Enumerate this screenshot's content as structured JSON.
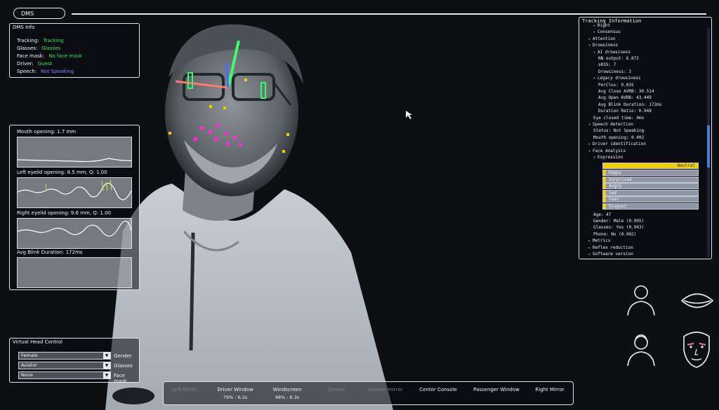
{
  "header": {
    "tab_label": "DMS"
  },
  "dms_info": {
    "title": "DMS Info",
    "rows": [
      {
        "label": "Tracking:",
        "value": "Tracking",
        "color": "#39e65c"
      },
      {
        "label": "Glasses:",
        "value": "Glasses",
        "color": "#39e65c"
      },
      {
        "label": "Face mask:",
        "value": "No face mask",
        "color": "#39e65c"
      },
      {
        "label": "Driver:",
        "value": "Guest",
        "color": "#39e65c"
      },
      {
        "label": "Speech:",
        "value": "Not Speaking",
        "color": "#7f8cff"
      }
    ]
  },
  "graphs": [
    {
      "label": "Mouth opening: 1.7 mm"
    },
    {
      "label": "Left eyelid opening: 8.5 mm, Q: 1.00"
    },
    {
      "label": "Right eyelid opening: 9.6 mm, Q: 1.00"
    },
    {
      "label": "Avg Blink Duration: 172ms"
    }
  ],
  "virtual_head": {
    "title": "Virtual Head Control",
    "controls": [
      {
        "value": "Female",
        "label": "Gender"
      },
      {
        "value": "Aviator",
        "label": "Glasses"
      },
      {
        "value": "None",
        "label": "Face mask"
      }
    ]
  },
  "bottom_bar": {
    "items": [
      {
        "label": "Left Mirror",
        "sub": "",
        "dim": true
      },
      {
        "label": "Driver Window",
        "sub": "79% : 6.2s",
        "dim": false
      },
      {
        "label": "Windscreen",
        "sub": "48% : 6.3s",
        "dim": false
      },
      {
        "label": "Cluster",
        "sub": "",
        "dim": true
      },
      {
        "label": "Interior mirror",
        "sub": "",
        "dim": true
      },
      {
        "label": "Center Console",
        "sub": "",
        "dim": false
      },
      {
        "label": "Passenger Window",
        "sub": "",
        "dim": false
      },
      {
        "label": "Right Mirror",
        "sub": "",
        "dim": false
      }
    ]
  },
  "tracking_info": {
    "title": "Tracking Information",
    "tree": [
      {
        "text": "Right",
        "indent": 2,
        "arrow": "▸"
      },
      {
        "text": "Consensus",
        "indent": 2,
        "arrow": "▸"
      },
      {
        "text": "Attention",
        "indent": 1,
        "arrow": "▸"
      },
      {
        "text": "Drowsiness",
        "indent": 1,
        "arrow": "▾"
      },
      {
        "text": "AI drowsiness",
        "indent": 2,
        "arrow": "▾"
      },
      {
        "text": "NN output: 6.872",
        "indent": 3,
        "arrow": ""
      },
      {
        "text": "sKSS: 7",
        "indent": 3,
        "arrow": ""
      },
      {
        "text": "Drowsiness: 3",
        "indent": 3,
        "arrow": ""
      },
      {
        "text": "Legacy drowsiness",
        "indent": 2,
        "arrow": "▾"
      },
      {
        "text": "PerClos: 0.035",
        "indent": 3,
        "arrow": ""
      },
      {
        "text": "Avg Close AVRB: 30.514",
        "indent": 3,
        "arrow": ""
      },
      {
        "text": "Avg Open AVRB: 43.449",
        "indent": 3,
        "arrow": ""
      },
      {
        "text": "Avg Blink Duration: 172ms",
        "indent": 3,
        "arrow": ""
      },
      {
        "text": "Duration Ratio: 0.948",
        "indent": 3,
        "arrow": ""
      },
      {
        "text": "Eye closed time: 0ms",
        "indent": 2,
        "arrow": ""
      },
      {
        "text": "Speech detection",
        "indent": 1,
        "arrow": "▾"
      },
      {
        "text": "Status: Not Speaking",
        "indent": 2,
        "arrow": ""
      },
      {
        "text": "Mouth opening: 0.002",
        "indent": 2,
        "arrow": ""
      },
      {
        "text": "Driver identification",
        "indent": 1,
        "arrow": "▸"
      },
      {
        "text": "Face Analysis",
        "indent": 1,
        "arrow": "▾"
      },
      {
        "text": "Expression",
        "indent": 2,
        "arrow": "▾"
      }
    ],
    "expressions": [
      {
        "label": "Neutral",
        "level": 1.0
      },
      {
        "label": "Happy",
        "level": 0.03
      },
      {
        "label": "Surprised",
        "level": 0.03
      },
      {
        "label": "Angry",
        "level": 0.03
      },
      {
        "label": "Sad",
        "level": 0.03
      },
      {
        "label": "Fear",
        "level": 0.03
      },
      {
        "label": "Disgust",
        "level": 0.03
      }
    ],
    "analysis": [
      {
        "text": "Age: 47",
        "indent": 2,
        "arrow": ""
      },
      {
        "text": "Gender: Male (0.905)",
        "indent": 2,
        "arrow": ""
      },
      {
        "text": "Glasses: Yes (0.943)",
        "indent": 2,
        "arrow": ""
      },
      {
        "text": "Phone: No (0.002)",
        "indent": 2,
        "arrow": ""
      },
      {
        "text": "Metrics",
        "indent": 1,
        "arrow": "▸"
      },
      {
        "text": "Reflex reduction",
        "indent": 1,
        "arrow": "▸"
      },
      {
        "text": "Software version",
        "indent": 1,
        "arrow": "▸"
      }
    ]
  },
  "icons": {
    "avatars": [
      "male-avatar-icon",
      "eye-icon",
      "female-avatar-icon",
      "face-icon"
    ]
  },
  "colors": {
    "tracking_green": "#39e65c",
    "speech_blue": "#7f8cff",
    "expression_yellow": "#f2d000",
    "landmark_magenta": "#ff2bd6"
  }
}
